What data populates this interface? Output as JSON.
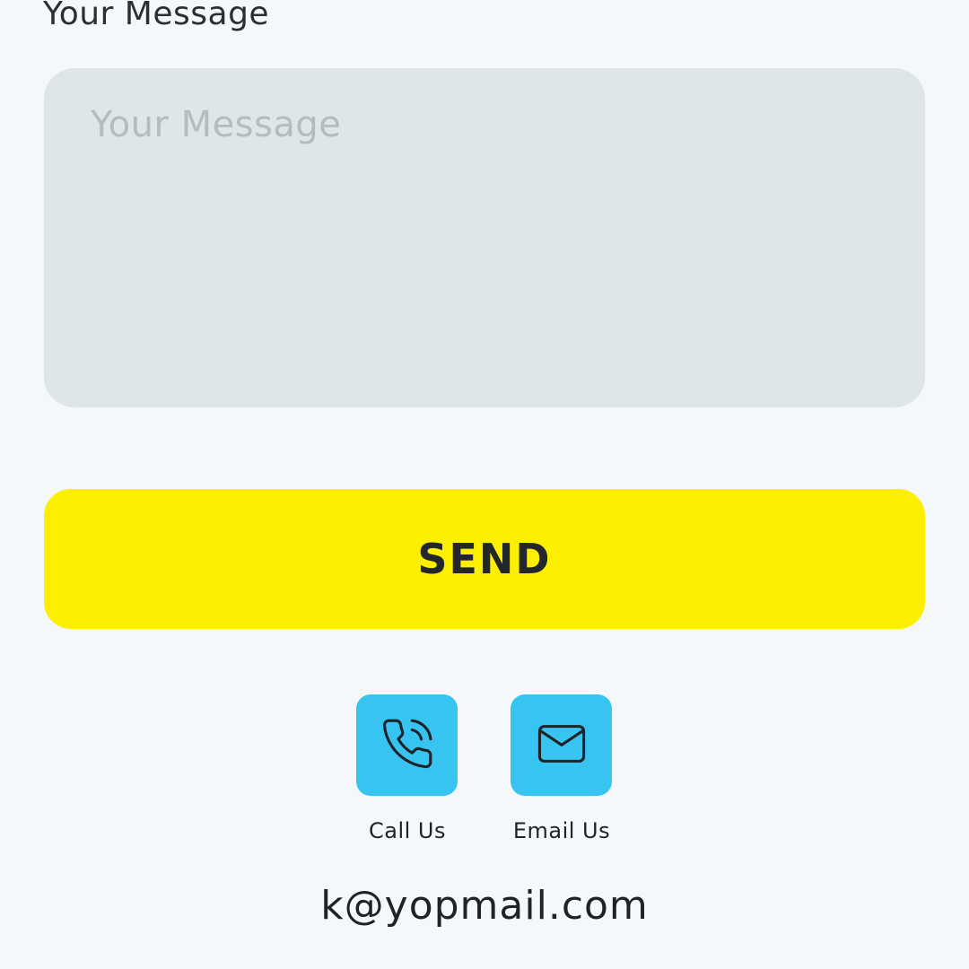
{
  "form": {
    "message_label": "Your Message",
    "message_placeholder": "Your Message",
    "message_value": "",
    "send_label": "SEND"
  },
  "contact": {
    "call": {
      "label": "Call Us",
      "icon": "phone-ringing-icon"
    },
    "email": {
      "label": "Email Us",
      "icon": "envelope-icon"
    },
    "email_address": "k@yopmail.com"
  },
  "colors": {
    "background": "#f4f8fa",
    "input_fill": "#dfe6e8",
    "send_button": "#fdef00",
    "contact_tile": "#38c4f0",
    "text": "#23272b"
  }
}
